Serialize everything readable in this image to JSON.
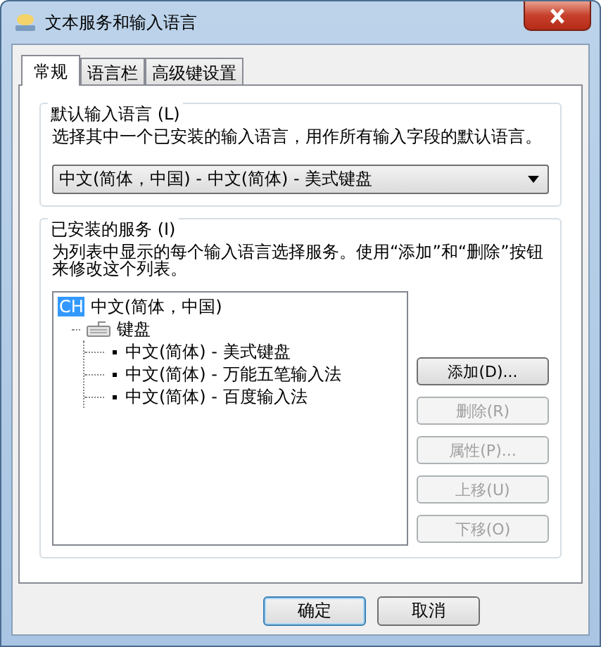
{
  "window": {
    "title": "文本服务和输入语言"
  },
  "tabs": [
    {
      "label": "常规",
      "selected": true
    },
    {
      "label": "语言栏",
      "selected": false
    },
    {
      "label": "高级键设置",
      "selected": false
    }
  ],
  "default_language": {
    "group_label": "默认输入语言 (L)",
    "description": "选择其中一个已安装的输入语言，用作所有输入字段的默认语言。",
    "dropdown_value": "中文(简体，中国) - 中文(简体) - 美式键盘"
  },
  "installed_services": {
    "group_label": "已安装的服务 (I)",
    "description": "为列表中显示的每个输入语言选择服务。使用“添加”和“删除”按钮来修改这个列表。",
    "tree": [
      {
        "badge": "CH",
        "label": "中文(简体，中国)",
        "children": [
          {
            "label": "键盘",
            "children": [
              {
                "label": "中文(简体) - 美式键盘"
              },
              {
                "label": "中文(简体) - 万能五笔输入法"
              },
              {
                "label": "中文(简体) - 百度输入法"
              }
            ]
          }
        ]
      }
    ],
    "buttons": [
      {
        "label": "添加(D)...",
        "disabled": false
      },
      {
        "label": "删除(R)",
        "disabled": true
      },
      {
        "label": "属性(P)...",
        "disabled": true
      },
      {
        "label": "上移(U)",
        "disabled": true
      },
      {
        "label": "下移(O)",
        "disabled": true
      }
    ]
  },
  "footer_buttons": [
    {
      "label": "确定",
      "default": true
    },
    {
      "label": "取消",
      "default": false
    }
  ]
}
